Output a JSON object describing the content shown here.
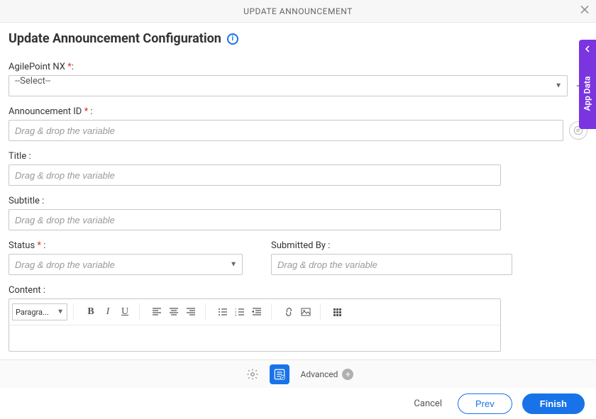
{
  "header": {
    "title": "UPDATE ANNOUNCEMENT"
  },
  "page": {
    "title": "Update Announcement Configuration"
  },
  "fields": {
    "agilepoint": {
      "label": "AgilePoint NX",
      "required_marker": "*",
      "colon": ":",
      "value": "--Select--"
    },
    "announcement_id": {
      "label": "Announcement ID",
      "required_marker": "*",
      "colon": " :",
      "placeholder": "Drag & drop the variable"
    },
    "title_field": {
      "label": "Title :",
      "placeholder": "Drag & drop the variable"
    },
    "subtitle": {
      "label": "Subtitle :",
      "placeholder": "Drag & drop the variable"
    },
    "status": {
      "label": "Status",
      "required_marker": "*",
      "colon": " :",
      "placeholder": "Drag & drop the variable"
    },
    "submitted_by": {
      "label": "Submitted By :",
      "placeholder": "Drag & drop the variable"
    },
    "content": {
      "label": "Content :",
      "format_btn": "Paragra..."
    }
  },
  "bottom": {
    "advanced": "Advanced"
  },
  "side": {
    "label": "App Data"
  },
  "footer": {
    "cancel": "Cancel",
    "prev": "Prev",
    "finish": "Finish"
  }
}
